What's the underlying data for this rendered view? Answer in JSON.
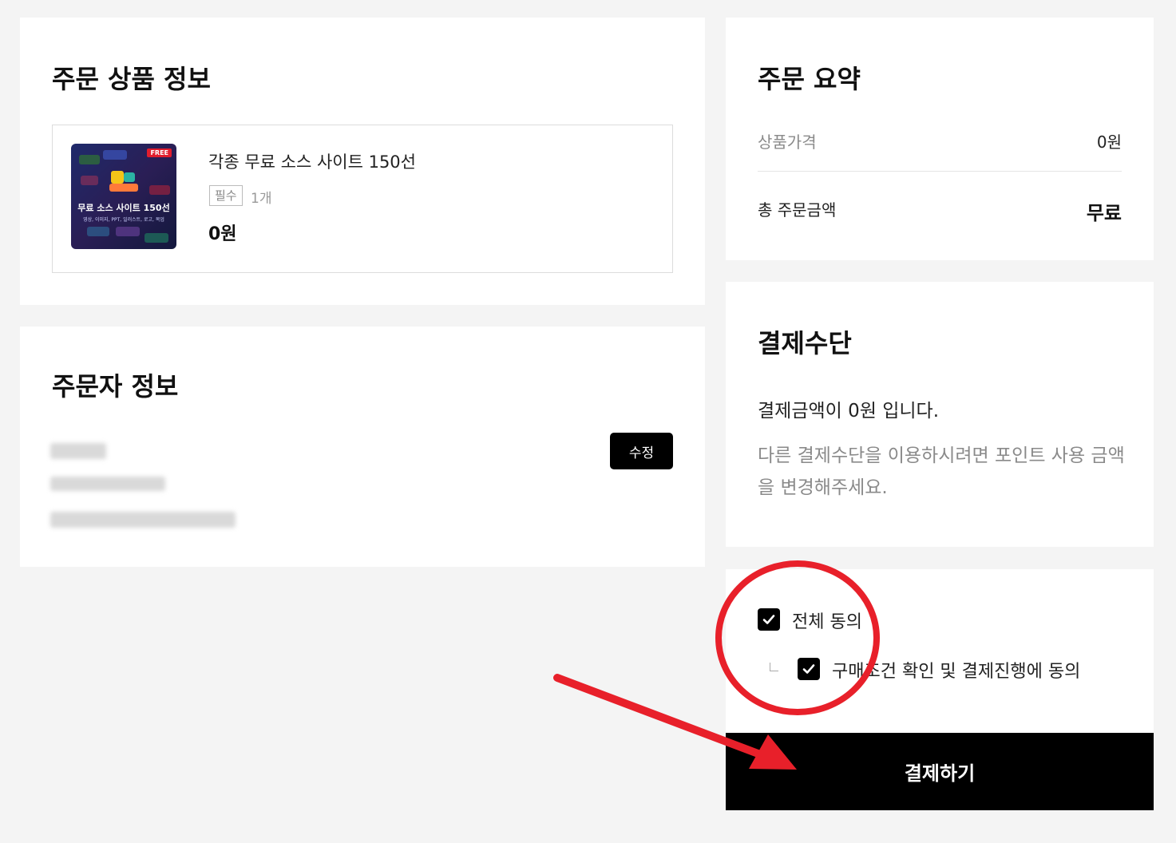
{
  "product_section": {
    "title": "주문 상품 정보",
    "item": {
      "thumbnail_badge": "FREE",
      "thumbnail_title": "무료 소스 사이트 150선",
      "thumbnail_subtitle": "영상, 이미지, PPT, 일러스트, 로고, 목업",
      "name": "각종 무료 소스 사이트 150선",
      "required_badge": "필수",
      "quantity": "1개",
      "price": "0원"
    }
  },
  "orderer_section": {
    "title": "주문자 정보",
    "edit_label": "수정"
  },
  "summary_section": {
    "title": "주문 요약",
    "product_price_label": "상품가격",
    "product_price_value": "0원",
    "total_label": "총 주문금액",
    "total_value": "무료"
  },
  "payment_section": {
    "title": "결제수단",
    "amount_text": "결제금액이 0원 입니다.",
    "hint_text": "다른 결제수단을 이용하시려면 포인트 사용 금액을 변경해주세요."
  },
  "agreement_section": {
    "agree_all_label": "전체 동의",
    "agree_purchase_label": "구매조건 확인 및 결제진행에 동의"
  },
  "pay_button_label": "결제하기",
  "colors": {
    "annotation_red": "#e8202a",
    "button_black": "#000000",
    "background": "#f4f4f4"
  }
}
